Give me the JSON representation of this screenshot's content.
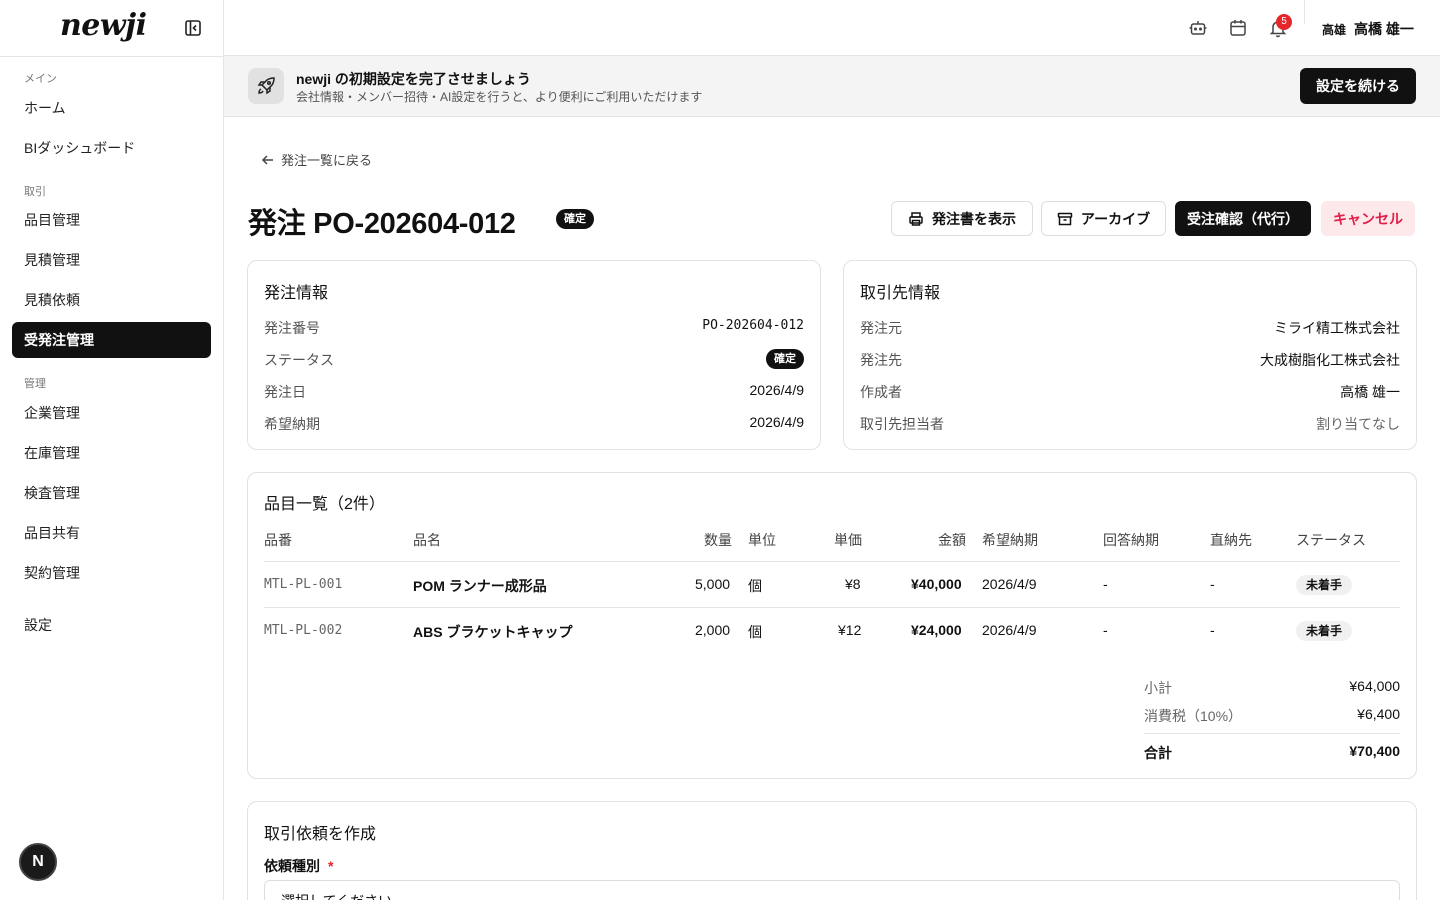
{
  "app": {
    "logo": "newji"
  },
  "sidebar": {
    "groups": {
      "main": "メイン",
      "trade": "取引",
      "manage": "管理"
    },
    "items": [
      {
        "label": "ホーム"
      },
      {
        "label": "BIダッシュボード"
      },
      {
        "label": "品目管理"
      },
      {
        "label": "見積管理"
      },
      {
        "label": "見積依頼"
      },
      {
        "label": "受発注管理"
      },
      {
        "label": "企業管理"
      },
      {
        "label": "在庫管理"
      },
      {
        "label": "検査管理"
      },
      {
        "label": "品目共有"
      },
      {
        "label": "契約管理"
      },
      {
        "label": "設定"
      }
    ],
    "footer_badge": "N"
  },
  "topbar": {
    "notification_count": "5",
    "user_short": "高雄",
    "user_name": "高橋 雄一"
  },
  "banner": {
    "title": "newji の初期設定を完了させましょう",
    "subtitle": "会社情報・メンバー招待・AI設定を行うと、より便利にご利用いただけます",
    "button": "設定を続ける"
  },
  "page": {
    "back_link": "発注一覧に戻る",
    "title": "発注 PO-202604-012",
    "status_badge": "確定",
    "actions": {
      "show_order": "発注書を表示",
      "archive": "アーカイブ",
      "confirm": "受注確認（代行）",
      "cancel": "キャンセル"
    }
  },
  "order_info": {
    "title": "発注情報",
    "rows": [
      {
        "label": "発注番号",
        "value": "PO-202604-012"
      },
      {
        "label": "ステータス",
        "value": "確定"
      },
      {
        "label": "発注日",
        "value": "2026/4/9"
      },
      {
        "label": "希望納期",
        "value": "2026/4/9"
      }
    ]
  },
  "partner_info": {
    "title": "取引先情報",
    "rows": [
      {
        "label": "発注元",
        "value": "ミライ精工株式会社"
      },
      {
        "label": "発注先",
        "value": "大成樹脂化工株式会社"
      },
      {
        "label": "作成者",
        "value": "高橋 雄一"
      },
      {
        "label": "取引先担当者",
        "value": "割り当てなし"
      }
    ]
  },
  "items": {
    "title": "品目一覧（2件）",
    "columns": [
      "品番",
      "品名",
      "数量",
      "単位",
      "単価",
      "金額",
      "希望納期",
      "回答納期",
      "直納先",
      "ステータス"
    ],
    "rows": [
      {
        "code": "MTL-PL-001",
        "name": "POM ランナー成形品",
        "qty": "5,000",
        "unit": "個",
        "price": "¥8",
        "amount": "¥40,000",
        "desired": "2026/4/9",
        "answered": "-",
        "direct": "-",
        "status": "未着手"
      },
      {
        "code": "MTL-PL-002",
        "name": "ABS ブラケットキャップ",
        "qty": "2,000",
        "unit": "個",
        "price": "¥12",
        "amount": "¥24,000",
        "desired": "2026/4/9",
        "answered": "-",
        "direct": "-",
        "status": "未着手"
      }
    ],
    "summary": {
      "subtotal_label": "小計",
      "subtotal": "¥64,000",
      "tax_label": "消費税（10%）",
      "tax": "¥6,400",
      "total_label": "合計",
      "total": "¥70,400"
    }
  },
  "request": {
    "title": "取引依頼を作成",
    "field_label": "依頼種別",
    "required_mark": "*",
    "select_value": "選択してください"
  }
}
